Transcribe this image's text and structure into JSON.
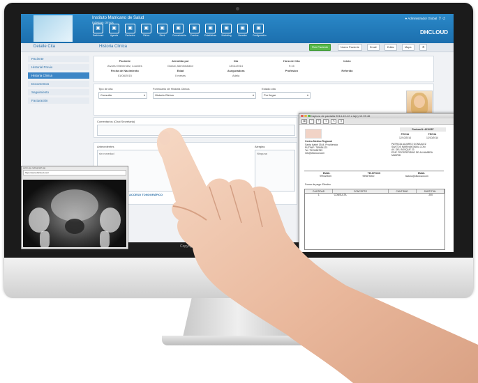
{
  "app": {
    "institution": "Instituto Matricano de Salud",
    "user_short": "Edelgan Olmos",
    "admin_label": "Administrador Global",
    "brand": "DHCLOUD"
  },
  "nav": [
    "Dashboard",
    "Agenda",
    "Pacientes",
    "Clinica",
    "Stock",
    "Comunicación",
    "Cuentas",
    "Estadisticas",
    "Marketing",
    "Usuarios",
    "Configuración"
  ],
  "titlebar": {
    "left": "Detalle Cita",
    "section": "Historia Clinica",
    "primary_button": "Fluir Paciente",
    "buttons": [
      "Nuevo Paciente",
      "Email",
      "Editar",
      "Mapa"
    ]
  },
  "sidebar": [
    {
      "label": "Paciente",
      "active": false
    },
    {
      "label": "Historial Previo",
      "active": false
    },
    {
      "label": "Historia Clinica",
      "active": true
    },
    {
      "label": "Documentos",
      "active": false
    },
    {
      "label": "Seguimiento",
      "active": false
    },
    {
      "label": "Facturación",
      "active": false
    }
  ],
  "appointment": {
    "fields": [
      {
        "k": "Paciente",
        "v": "Alvarez Menendez, Lourdes"
      },
      {
        "k": "Atendida por",
        "v": "Global, Administrator"
      },
      {
        "k": "Dia",
        "v": "18/11/2014"
      },
      {
        "k": "Hora de Cita",
        "v": "9:15"
      },
      {
        "k": "Inicio",
        "v": ""
      },
      {
        "k": "Fecha de Nacimiento",
        "v": "01/08/2015"
      },
      {
        "k": "Edad",
        "v": "0 meses"
      },
      {
        "k": "Aseguradora",
        "v": "Adela"
      },
      {
        "k": "Profesion",
        "v": ""
      },
      {
        "k": "Referido",
        "v": ""
      }
    ]
  },
  "form": {
    "tipo_label": "Tipo de cita",
    "tipo_value": "Consulta",
    "formulario_label": "Formulario de Historia Clinica",
    "formulario_value": "Historia Clinica",
    "estado_label": "Estado cita",
    "estado_value": "Por llegar",
    "comentarios_label": "Comentarios (Chat Secretaria)",
    "antecedentes_label": "Antecedentes",
    "antecedentes_value": "sin novedad",
    "alergias_label": "Alergias",
    "alergias_value": "Ninguna",
    "link_label": "ACCESO TONOGRÁFICO"
  },
  "capture_window": {
    "title": "Captura de pantalla 2014-10-12 a la(s) 12.09.46",
    "invoice_title": "Factura Nº 4010287",
    "company": "Centro Medico Regional",
    "company_lines": [
      "Santa Isabel 1544, Providencia",
      "RUT/NIF: 789654123",
      "Tel: 7513456789",
      "info@dhcloud.com"
    ],
    "meta_head": [
      "FECHA",
      "FECHA"
    ],
    "meta_vals": [
      "12/10/2014",
      "12/10/2014"
    ],
    "client_lines": [
      "PATRICIA ALVAREZ GONZALEZ",
      "SANTOS MARIN@GMAIL.COM",
      "AV. DEL BOSQUE 23",
      "EDIF. PROSPERIDAD DE ALHAMBRA",
      "MADRID"
    ],
    "contact_head": [
      "EMAIL",
      "TELEFONO",
      "EMAIL"
    ],
    "contact_vals": [
      "999420000",
      "999875000",
      "factura@dhcloud.com"
    ],
    "payment": "Forma de pago: Efectivo",
    "table_head": [
      "CANTIDAD",
      "CONCEPTO",
      "CANTIDAD",
      "SUBTOTAL"
    ],
    "table_row": [
      "1",
      "CONSULTA",
      "",
      "200"
    ]
  },
  "xray_window": {
    "title": "pelvis-ap-radiograph.jpg",
    "url": "https://www.dhcloud.com/"
  },
  "footer_text": "Copyright"
}
